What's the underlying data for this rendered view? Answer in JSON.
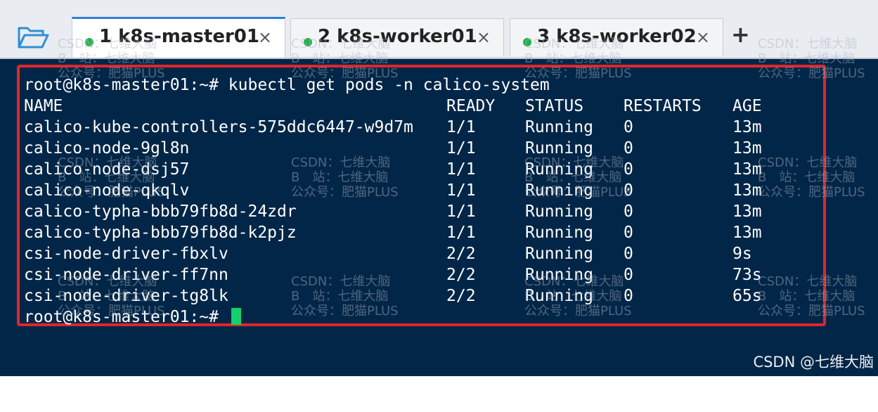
{
  "tabs": [
    {
      "label": "1 k8s-master01",
      "close": "×",
      "active": true
    },
    {
      "label": "2 k8s-worker01",
      "close": "×",
      "active": false
    },
    {
      "label": "3 k8s-worker02",
      "close": "×",
      "active": false
    }
  ],
  "new_tab": "+",
  "terminal": {
    "command_line": "root@k8s-master01:~# kubectl get pods -n calico-system",
    "headers": {
      "name": "NAME",
      "ready": "READY",
      "status": "STATUS",
      "restarts": "RESTARTS",
      "age": "AGE"
    },
    "rows": [
      {
        "name": "calico-kube-controllers-575ddc6447-w9d7m",
        "ready": "1/1",
        "status": "Running",
        "restarts": "0",
        "age": "13m"
      },
      {
        "name": "calico-node-9gl8n",
        "ready": "1/1",
        "status": "Running",
        "restarts": "0",
        "age": "13m"
      },
      {
        "name": "calico-node-dsj57",
        "ready": "1/1",
        "status": "Running",
        "restarts": "0",
        "age": "13m"
      },
      {
        "name": "calico-node-qkqlv",
        "ready": "1/1",
        "status": "Running",
        "restarts": "0",
        "age": "13m"
      },
      {
        "name": "calico-typha-bbb79fb8d-24zdr",
        "ready": "1/1",
        "status": "Running",
        "restarts": "0",
        "age": "13m"
      },
      {
        "name": "calico-typha-bbb79fb8d-k2pjz",
        "ready": "1/1",
        "status": "Running",
        "restarts": "0",
        "age": "13m"
      },
      {
        "name": "csi-node-driver-fbxlv",
        "ready": "2/2",
        "status": "Running",
        "restarts": "0",
        "age": "9s"
      },
      {
        "name": "csi-node-driver-ff7nn",
        "ready": "2/2",
        "status": "Running",
        "restarts": "0",
        "age": "73s"
      },
      {
        "name": "csi-node-driver-tg8lk",
        "ready": "2/2",
        "status": "Running",
        "restarts": "0",
        "age": "65s"
      }
    ],
    "prompt": "root@k8s-master01:~# "
  },
  "watermark": "CSDN：七维大脑\nB　站：七维大脑\n公众号：肥猫PLUS",
  "brand": "CSDN @七维大脑",
  "colors": {
    "terminal_bg": "#022647",
    "highlight": "#e0262a",
    "cursor": "#15d16b",
    "tab_dot": "#22b14c",
    "tab_accent": "#2f7fd8"
  }
}
